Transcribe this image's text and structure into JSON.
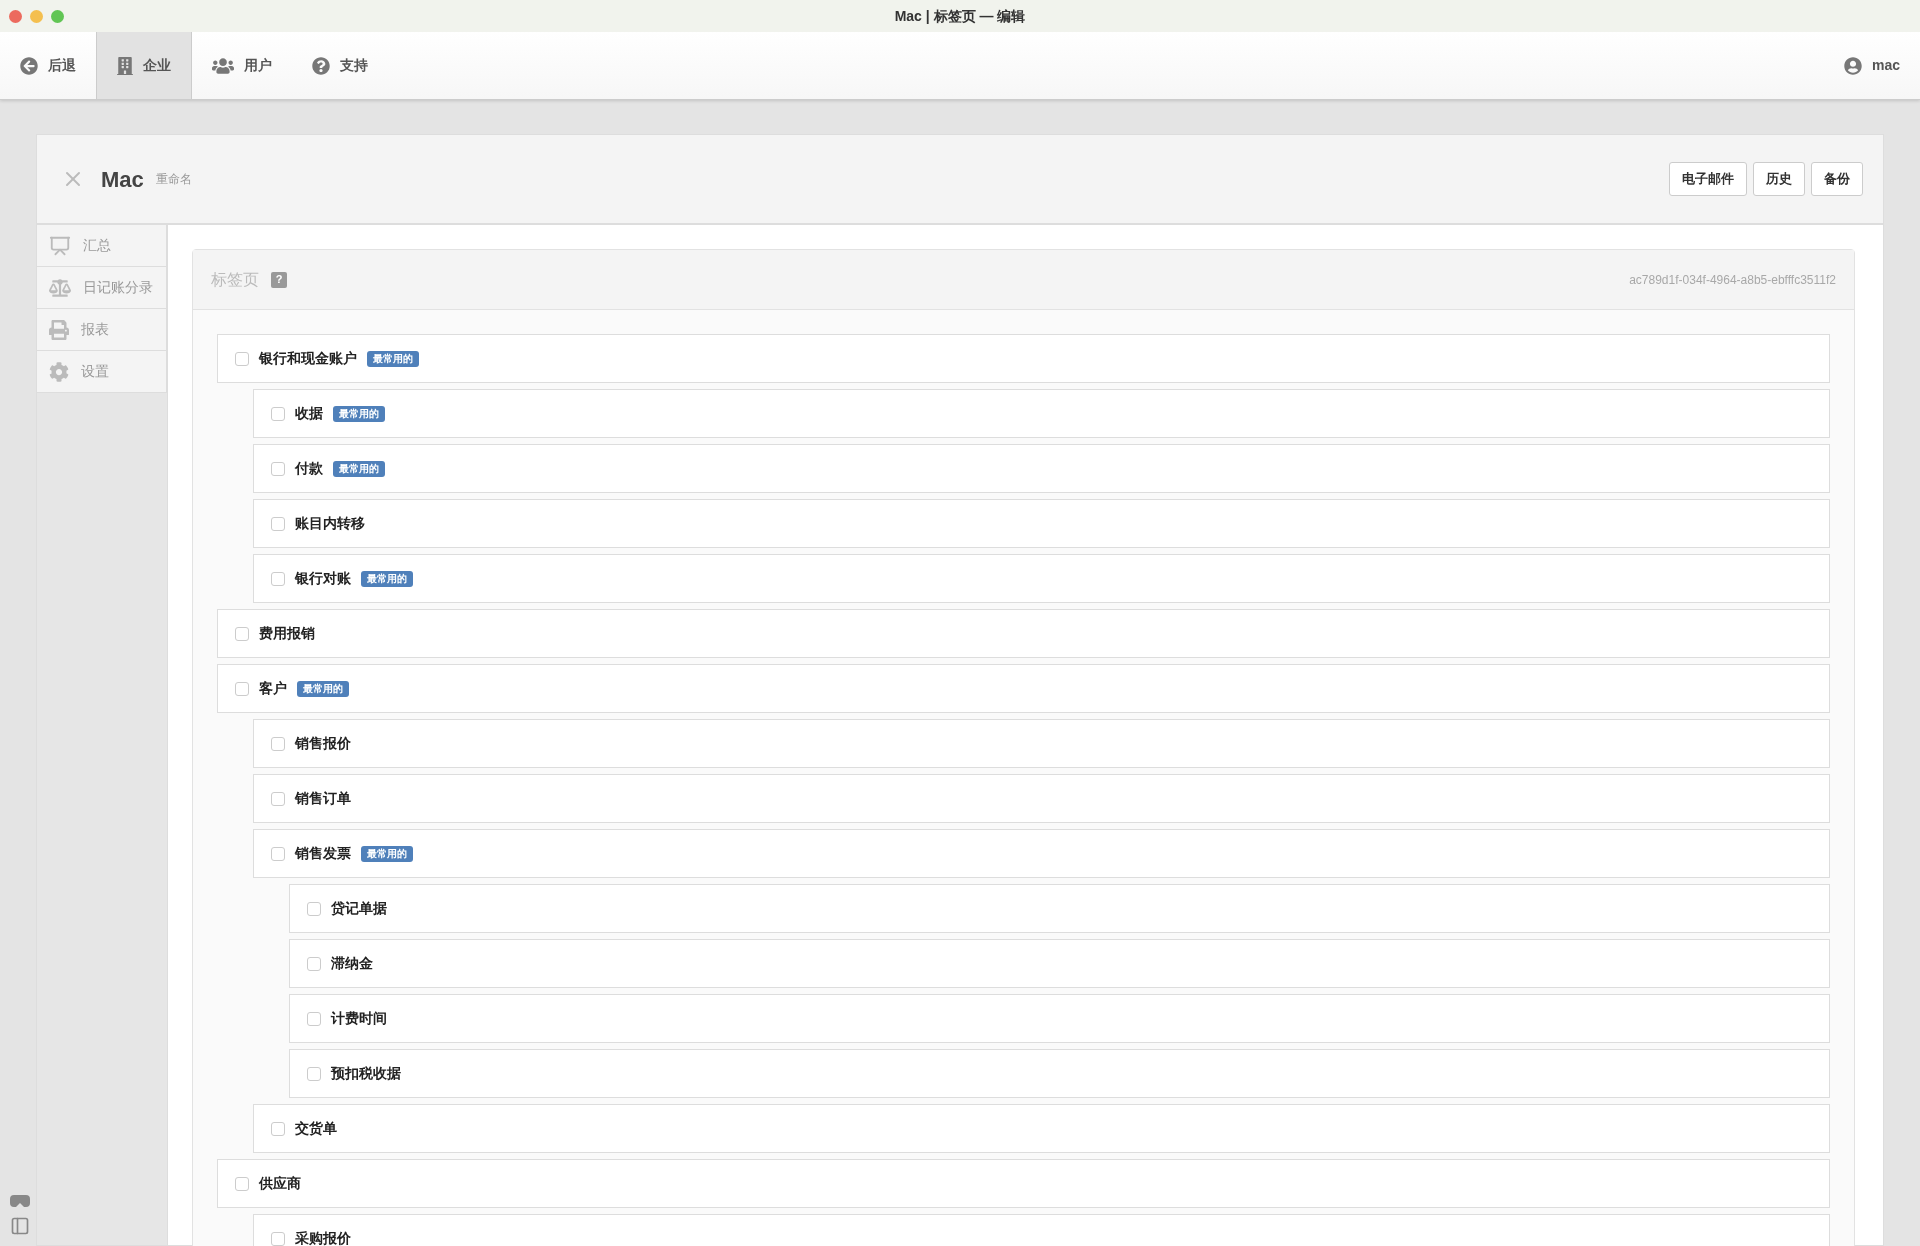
{
  "window": {
    "title": "Mac | 标签页 — 编辑"
  },
  "toolbar": {
    "items": [
      {
        "label": "后退",
        "kind": "back",
        "selected": false
      },
      {
        "label": "企业",
        "kind": "company",
        "selected": true
      },
      {
        "label": "用户",
        "kind": "users",
        "selected": false
      },
      {
        "label": "支持",
        "kind": "help",
        "selected": false
      }
    ],
    "user": "mac"
  },
  "header": {
    "title": "Mac",
    "rename": "重命名",
    "buttons": [
      "电子邮件",
      "历史",
      "备份"
    ]
  },
  "sidebar": {
    "items": [
      {
        "label": "汇总",
        "kind": "summary"
      },
      {
        "label": "日记账分录",
        "kind": "journal"
      },
      {
        "label": "报表",
        "kind": "report"
      },
      {
        "label": "设置",
        "kind": "settings"
      }
    ]
  },
  "card": {
    "title": "标签页",
    "help": "?",
    "id": "ac789d1f-034f-4964-a8b5-ebfffc3511f2"
  },
  "tree": [
    {
      "label": "银行和现金账户",
      "badge": "最常用的",
      "checked": false,
      "children": [
        {
          "label": "收据",
          "badge": "最常用的",
          "checked": false
        },
        {
          "label": "付款",
          "badge": "最常用的",
          "checked": false
        },
        {
          "label": "账目内转移",
          "checked": false
        },
        {
          "label": "银行对账",
          "badge": "最常用的",
          "checked": false
        }
      ]
    },
    {
      "label": "费用报销",
      "checked": false
    },
    {
      "label": "客户",
      "badge": "最常用的",
      "checked": false,
      "children": [
        {
          "label": "销售报价",
          "checked": false
        },
        {
          "label": "销售订单",
          "checked": false
        },
        {
          "label": "销售发票",
          "badge": "最常用的",
          "checked": false,
          "children": [
            {
              "label": "贷记单据",
              "checked": false
            },
            {
              "label": "滞纳金",
              "checked": false
            },
            {
              "label": "计费时间",
              "checked": false
            },
            {
              "label": "预扣税收据",
              "checked": false
            }
          ]
        },
        {
          "label": "交货单",
          "checked": false
        }
      ]
    },
    {
      "label": "供应商",
      "checked": false,
      "children": [
        {
          "label": "采购报价",
          "checked": false
        }
      ]
    }
  ]
}
